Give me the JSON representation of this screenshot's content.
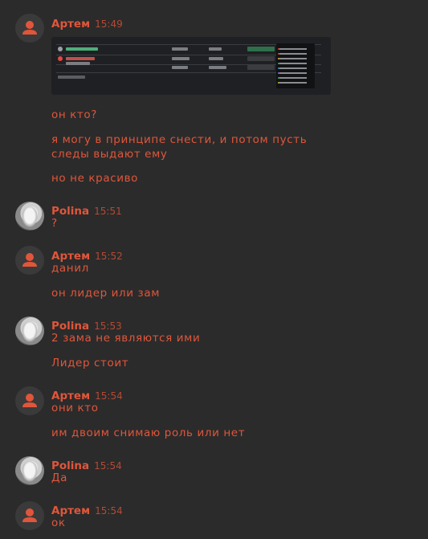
{
  "messages": [
    {
      "author": "Артем",
      "time": "15:49",
      "avatar": "default-avatar-icon",
      "lines": [
        "он кто?",
        "я могу в принципе снести, и потом пусть следы выдают ему",
        "но не красиво"
      ],
      "has_attachment": true
    },
    {
      "author": "Polina",
      "time": "15:51",
      "avatar": "photo",
      "lines": [
        "?"
      ]
    },
    {
      "author": "Артем",
      "time": "15:52",
      "avatar": "default-avatar-icon",
      "lines": [
        "данил",
        "он лидер или зам"
      ]
    },
    {
      "author": "Polina",
      "time": "15:53",
      "avatar": "photo",
      "lines": [
        "2 зама не являются ими",
        "Лидер стоит"
      ]
    },
    {
      "author": "Артем",
      "time": "15:54",
      "avatar": "default-avatar-icon",
      "lines": [
        "они кто",
        "им двоим снимаю роль или нет"
      ]
    },
    {
      "author": "Polina",
      "time": "15:54",
      "avatar": "photo",
      "lines": [
        "Да"
      ]
    },
    {
      "author": "Артем",
      "time": "15:54",
      "avatar": "default-avatar-icon",
      "lines": [
        "ок"
      ]
    }
  ],
  "colors": {
    "background": "#2b2b2b",
    "accent": "#e0563b",
    "timestamp": "#b44a34"
  }
}
